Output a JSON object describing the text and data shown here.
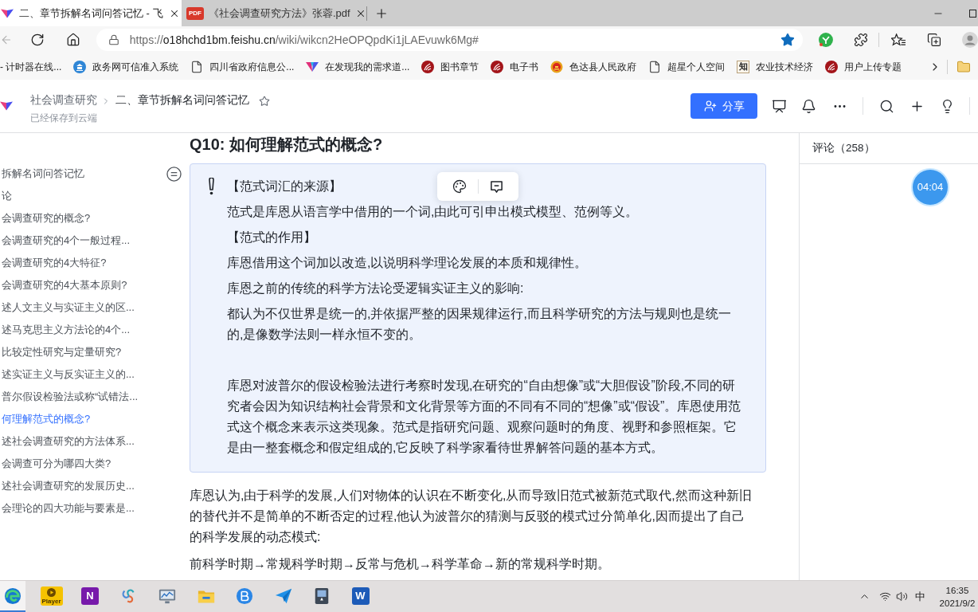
{
  "browser": {
    "tabs": [
      {
        "title": "二、章节拆解名词问答记忆 - 飞",
        "kind": "doc",
        "selected": true
      },
      {
        "title": "《社会调查研究方法》张蓉.pdf",
        "kind": "pdf",
        "glyph": "PDF",
        "selected": false
      }
    ],
    "address": {
      "scheme": "https://",
      "host": "o18hchd1bm.feishu.cn",
      "path": "/wiki/wikcn2HeOPQpdKi1jLAEvuwk6Mg#",
      "favorite": true
    },
    "bookmarks": [
      {
        "label": "- 计时器在线..."
      },
      {
        "label": "政务网可信准入系统",
        "kind": "building"
      },
      {
        "label": "四川省政府信息公...",
        "kind": "page"
      },
      {
        "label": "在发现我的需求道...",
        "kind": "v-logo"
      },
      {
        "label": "图书章节",
        "kind": "seal"
      },
      {
        "label": "电子书",
        "kind": "seal"
      },
      {
        "label": "色达县人民政府",
        "kind": "emblem"
      },
      {
        "label": "超星个人空间",
        "kind": "page"
      },
      {
        "label": "农业技术经济",
        "kind": "glyph",
        "glyph": "知"
      },
      {
        "label": "用户上传专题",
        "kind": "seal"
      }
    ]
  },
  "doc_header": {
    "breadcrumb": [
      "社会调查研究",
      "二、章节拆解名词问答记忆"
    ],
    "starred": false,
    "save_status": "已经保存到云端",
    "share": "分享"
  },
  "outline": {
    "items": [
      {
        "label": "拆解名词问答记忆",
        "selected": false
      },
      {
        "label": "论",
        "selected": false
      },
      {
        "label": "会调查研究的概念?",
        "selected": false
      },
      {
        "label": "会调查研究的4个一般过程...",
        "selected": false
      },
      {
        "label": "会调查研究的4大特征?",
        "selected": false
      },
      {
        "label": "会调查研究的4大基本原则?",
        "selected": false
      },
      {
        "label": "述人文主义与实证主义的区...",
        "selected": false
      },
      {
        "label": "述马克思主义方法论的4个...",
        "selected": false
      },
      {
        "label": "比较定性研究与定量研究?",
        "selected": false
      },
      {
        "label": "述实证主义与反实证主义的...",
        "selected": false
      },
      {
        "label": "普尔假设检验法或称“试错法...",
        "selected": false
      },
      {
        "label": "何理解范式的概念?",
        "selected": true
      },
      {
        "label": "述社会调查研究的方法体系...",
        "selected": false
      },
      {
        "label": "会调查可分为哪四大类?",
        "selected": false
      },
      {
        "label": "述社会调查研究的发展历史...",
        "selected": false
      },
      {
        "label": "会理论的四大功能与要素是...",
        "selected": false
      }
    ]
  },
  "document": {
    "heading": "Q10: 如何理解范式的概念?",
    "callout": {
      "groups": [
        [
          "【范式词汇的来源】",
          "范式是库恩从语言学中借用的一个词,由此可引申出模式模型、范例等义。",
          "【范式的作用】",
          "库恩借用这个词加以改造,以说明科学理论发展的本质和规律性。",
          "库恩之前的传统的科学方法论受逻辑实证主义的影响:",
          "都认为不仅世界是统一的,并依据严整的因果规律运行,而且科学研究的方法与规则也是统一的,是像数学法则一样永恒不变的。"
        ],
        [
          "库恩对波普尔的假设检验法进行考察时发现,在研究的“自由想像”或“大胆假设”阶段,不同的研究者会因为知识结构社会背景和文化背景等方面的不同有不同的“想像”或“假设”。库恩使用范式这个概念来表示这类现象。范式是指研究问题、观察问题时的角度、视野和参照框架。它是由一整套概念和假定组成的,它反映了科学家看待世界解答问题的基本方式。"
        ]
      ]
    },
    "paragraphs": [
      "库恩认为,由于科学的发展,人们对物体的认识在不断变化,从而导致旧范式被新范式取代,然而这种新旧的替代并不是简单的不断否定的过程,他认为波普尔的猜测与反驳的模式过分简单化,因而提出了自己的科学发展的动态模式:",
      "前科学时期→常规科学时期→反常与危机→科学革命→新的常规科学时期。"
    ]
  },
  "comments": {
    "label": "评论（258）"
  },
  "recording_timer": "04:04",
  "taskbar": {
    "apps": [
      {
        "kind": "edge",
        "active": true
      },
      {
        "kind": "player",
        "glyph": "Player",
        "active": false
      },
      {
        "kind": "onenote",
        "glyph": "N",
        "active": false
      },
      {
        "kind": "swirl",
        "active": false
      },
      {
        "kind": "monitor",
        "active": false
      },
      {
        "kind": "explorer",
        "active": false
      },
      {
        "kind": "b-circle",
        "active": false
      },
      {
        "kind": "paper-plane",
        "active": false
      },
      {
        "kind": "dark-app",
        "active": false
      },
      {
        "kind": "word",
        "glyph": "W",
        "active": false
      }
    ],
    "ime": "中",
    "time": "16:35",
    "date": "2021/9/2"
  }
}
